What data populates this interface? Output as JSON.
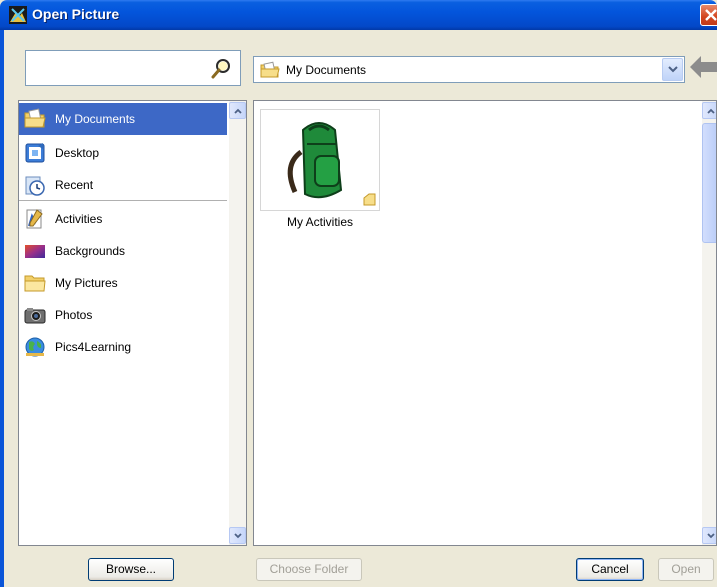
{
  "window": {
    "title": "Open Picture"
  },
  "search": {
    "placeholder": "",
    "value": ""
  },
  "location": {
    "current": "My Documents"
  },
  "sidebar": {
    "items": [
      {
        "label": "My Documents",
        "icon": "my-documents-icon",
        "selected": true
      },
      {
        "label": "Desktop",
        "icon": "desktop-icon",
        "selected": false
      },
      {
        "label": "Recent",
        "icon": "recent-icon",
        "selected": false
      },
      {
        "label": "Activities",
        "icon": "activities-icon",
        "selected": false
      },
      {
        "label": "Backgrounds",
        "icon": "backgrounds-icon",
        "selected": false
      },
      {
        "label": "My Pictures",
        "icon": "folder-icon",
        "selected": false
      },
      {
        "label": "Photos",
        "icon": "camera-icon",
        "selected": false
      },
      {
        "label": "Pics4Learning",
        "icon": "globe-icon",
        "selected": false
      }
    ]
  },
  "files": [
    {
      "label": "My Activities",
      "icon": "backpack-folder-icon"
    }
  ],
  "buttons": {
    "browse": "Browse...",
    "choose_folder": "Choose Folder",
    "cancel": "Cancel",
    "open": "Open"
  },
  "colors": {
    "titlebar": "#0355DC",
    "selection": "#3D68C6",
    "dialog_bg": "#ECE9D8"
  }
}
